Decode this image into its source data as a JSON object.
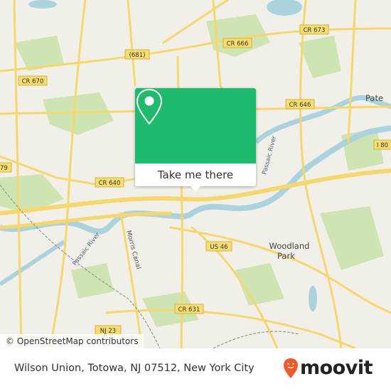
{
  "map": {
    "labels": {
      "cr673": "CR 673",
      "cr666": "CR 666",
      "r681": "(681)",
      "cr670": "CR 670",
      "cr646": "CR 646",
      "paterson": "Pate",
      "i80": "I 80",
      "r79": "79",
      "cr640": "CR 640",
      "passaic_river_1": "Passaic River",
      "passaic_river_2": "Passaic River",
      "morris_canal": "Morris Canal",
      "us46": "US 46",
      "woodland_park_1": "Woodland",
      "woodland_park_2": "Park",
      "cr631": "CR 631",
      "nj23": "NJ 23"
    },
    "colors": {
      "land": "#f2efe9",
      "park": "#c8e0a8",
      "water": "#aad3df",
      "road": "#f7dc6f",
      "accent": "#1fba6b"
    }
  },
  "popup": {
    "icon": "map-pin-icon",
    "button_label": "Take me there"
  },
  "attribution": "© OpenStreetMap contributors",
  "footer": {
    "address": "Wilson Union, Totowa, NJ 07512, New York City",
    "brand": "moovit",
    "brand_color": "#f0592a"
  }
}
